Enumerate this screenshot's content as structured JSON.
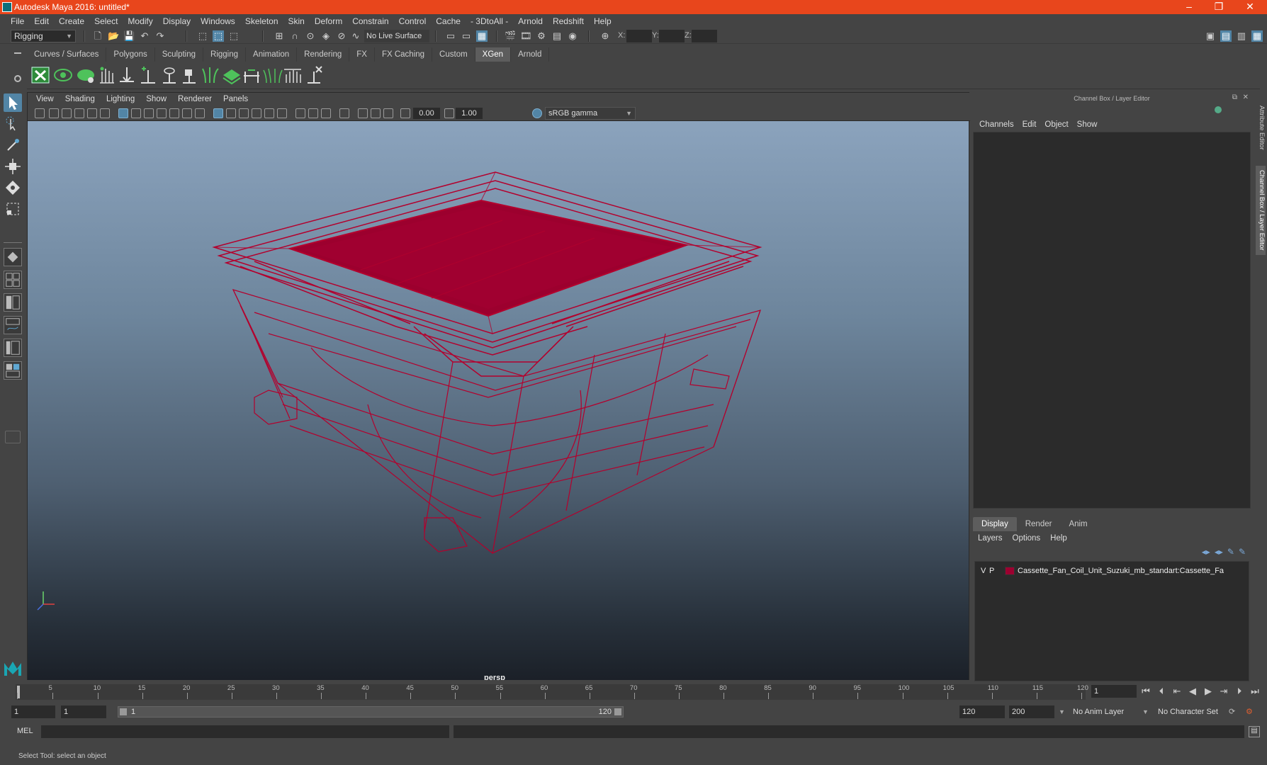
{
  "window": {
    "title": "Autodesk Maya 2016: untitled*",
    "minimize": "–",
    "maximize": "❐",
    "close": "✕"
  },
  "menubar": [
    "File",
    "Edit",
    "Create",
    "Select",
    "Modify",
    "Display",
    "Windows",
    "Skeleton",
    "Skin",
    "Deform",
    "Constrain",
    "Control",
    "Cache",
    "- 3DtoAll -",
    "Arnold",
    "Redshift",
    "Help"
  ],
  "statusline": {
    "mode": "Rigging",
    "live_surface": "No Live Surface",
    "x_label": "X:",
    "y_label": "Y:",
    "z_label": "Z:",
    "x_value": "",
    "y_value": "",
    "z_value": ""
  },
  "shelf": {
    "tabs": [
      "Curves / Surfaces",
      "Polygons",
      "Sculpting",
      "Rigging",
      "Animation",
      "Rendering",
      "FX",
      "FX Caching",
      "Custom",
      "XGen",
      "Arnold"
    ],
    "active_tab": "XGen",
    "icons": [
      "xgen-logo-icon",
      "xgen-preview-icon",
      "xgen-description-icon",
      "xgen-guides-icon",
      "xgen-place-guide-icon",
      "xgen-add-guide-icon",
      "xgen-sculpt-icon",
      "xgen-lock-icon",
      "xgen-groom-icon",
      "xgen-layer-icon",
      "xgen-cut-icon",
      "xgen-comb-icon",
      "xgen-length-icon",
      "xgen-delete-icon"
    ]
  },
  "viewport": {
    "menu": [
      "View",
      "Shading",
      "Lighting",
      "Show",
      "Renderer",
      "Panels"
    ],
    "exposure": "0.00",
    "gamma": "1.00",
    "color_management": "sRGB gamma",
    "camera": "persp",
    "wire_color": "#b3002d",
    "fill_color": "#9c002e"
  },
  "channelbox": {
    "title": "Channel Box / Layer Editor",
    "menu": [
      "Channels",
      "Edit",
      "Object",
      "Show"
    ],
    "layer_tabs": [
      "Display",
      "Render",
      "Anim"
    ],
    "active_layer_tab": "Display",
    "layer_menu": [
      "Layers",
      "Options",
      "Help"
    ],
    "layers": [
      {
        "visible": "V",
        "playback": "P",
        "name": "Cassette_Fan_Coil_Unit_Suzuki_mb_standart:Cassette_Fa",
        "color": "#9c0030"
      }
    ]
  },
  "sidetabs": [
    "Attribute Editor",
    "Channel Box / Layer Editor"
  ],
  "timeslider": {
    "ticks": [
      1,
      5,
      10,
      15,
      20,
      25,
      30,
      35,
      40,
      45,
      50,
      55,
      60,
      65,
      70,
      75,
      80,
      85,
      90,
      95,
      100,
      105,
      110,
      115,
      120
    ],
    "current_frame": "1"
  },
  "rangeslider": {
    "start": "1",
    "playback_start": "1",
    "range_start": "1",
    "range_end": "120",
    "playback_end": "120",
    "end": "200",
    "anim_layer": "No Anim Layer",
    "character_set": "No Character Set"
  },
  "cmdline": {
    "label": "MEL"
  },
  "helpline": {
    "text": "Select Tool: select an object"
  }
}
